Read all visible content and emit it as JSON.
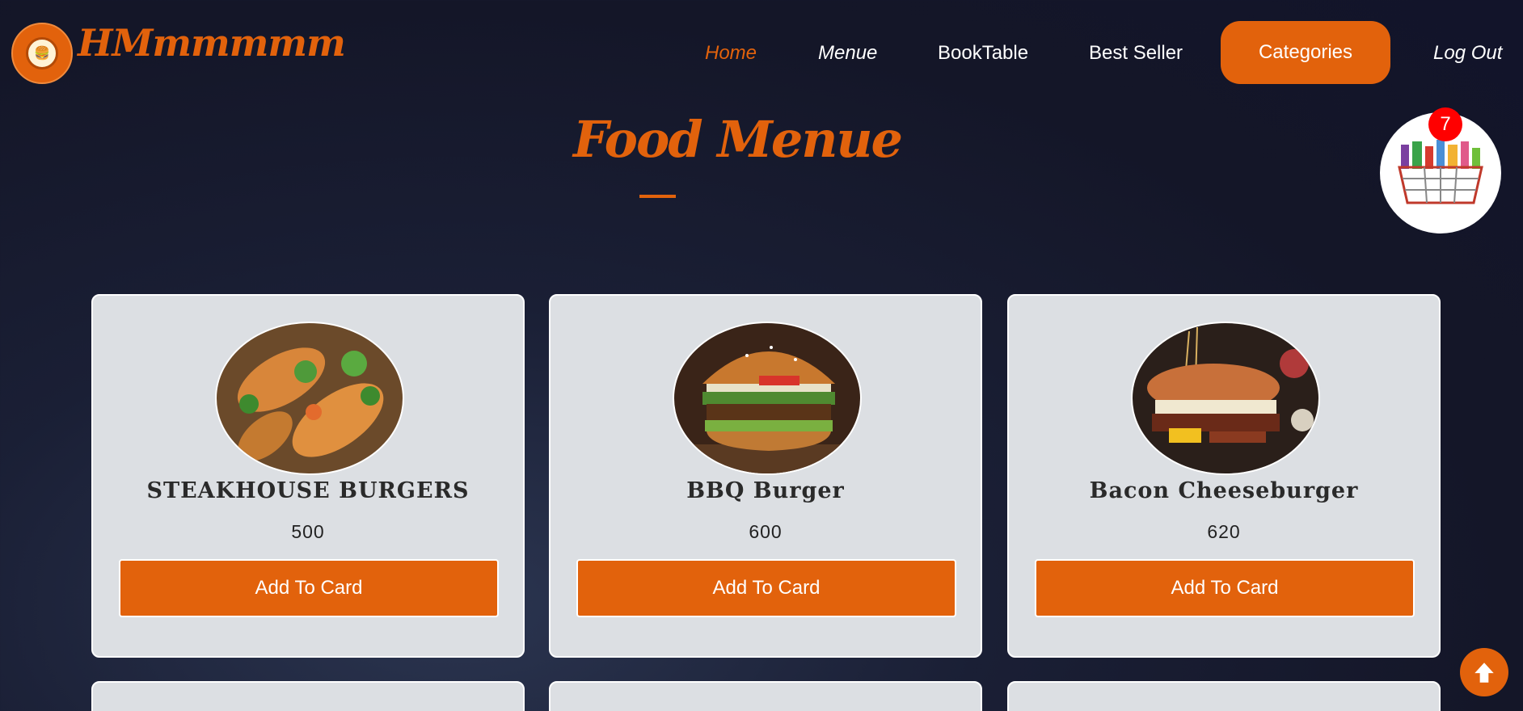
{
  "brand": {
    "name": "HMmmmmm",
    "logo_text": "🍔"
  },
  "nav": {
    "home": "Home",
    "menue": "Menue",
    "booktable": "BookTable",
    "bestseller": "Best Seller",
    "categories": "Categories",
    "logout": "Log Out"
  },
  "page": {
    "title": "Food Menue"
  },
  "cart": {
    "count": "7"
  },
  "cards": [
    {
      "name": "STEAKHOUSE BURGERS",
      "price": "500",
      "button": "Add To Card"
    },
    {
      "name": "BBQ Burger",
      "price": "600",
      "button": "Add To Card"
    },
    {
      "name": "Bacon Cheeseburger",
      "price": "620",
      "button": "Add To Card"
    }
  ],
  "colors": {
    "accent": "#e2620c",
    "card_bg": "#dcdfe3",
    "badge": "#ff0000"
  }
}
